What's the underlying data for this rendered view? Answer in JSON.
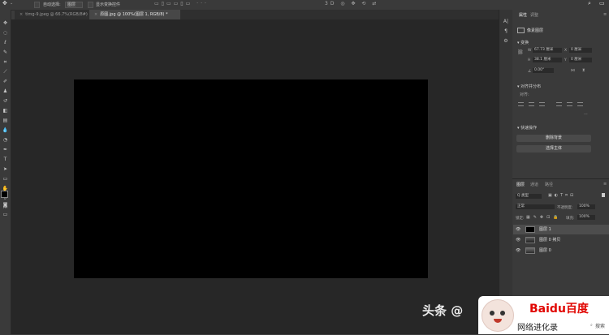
{
  "options_bar": {
    "auto_select_label": "自动选择:",
    "auto_select_value": "图层",
    "show_transform_label": "显示变换控件"
  },
  "tabs": [
    {
      "label": "timg-9.jpeg @ 66.7%(RGB/8#)",
      "active": false
    },
    {
      "label": "原图.jpg @ 100%(图层 1, RGB/8) *",
      "active": true
    }
  ],
  "properties": {
    "tabs": [
      "属性",
      "调整"
    ],
    "layer_kind": "像素图层",
    "transform_title": "变换",
    "w_label": "W",
    "w_value": "67.73 厘米",
    "x_label": "X",
    "x_value": "0 厘米",
    "h_label": "H",
    "h_value": "38.1 厘米",
    "y_label": "Y",
    "y_value": "0 厘米",
    "angle_value": "0.00°",
    "align_title": "对齐并分布",
    "align_sub": "对齐:",
    "quick_actions_title": "快速操作",
    "remove_bg_button": "删除背景",
    "select_subject_button": "选择主体"
  },
  "layers_panel": {
    "tabs": [
      "图层",
      "通道",
      "路径"
    ],
    "filter_value": "Q 类型",
    "blend_mode": "正常",
    "opacity_label": "不透明度:",
    "opacity_value": "100%",
    "lock_label": "锁定:",
    "fill_label": "填充:",
    "fill_value": "100%",
    "layers": [
      {
        "name": "图层 1",
        "selected": true
      },
      {
        "name": "图层 0 拷贝",
        "selected": false
      },
      {
        "name": "图层 0",
        "selected": false
      }
    ]
  },
  "watermark": {
    "toutiao_text": "头条 @",
    "baidu_logo_text": "Baidu百度",
    "site_text": "网络进化录",
    "search_text": "搜索"
  },
  "colors": {
    "workspace": "#272727",
    "canvas": "#000000",
    "panel": "#3a3a3a",
    "baidu_red": "#e10602",
    "baidu_blue": "#2932e1"
  }
}
